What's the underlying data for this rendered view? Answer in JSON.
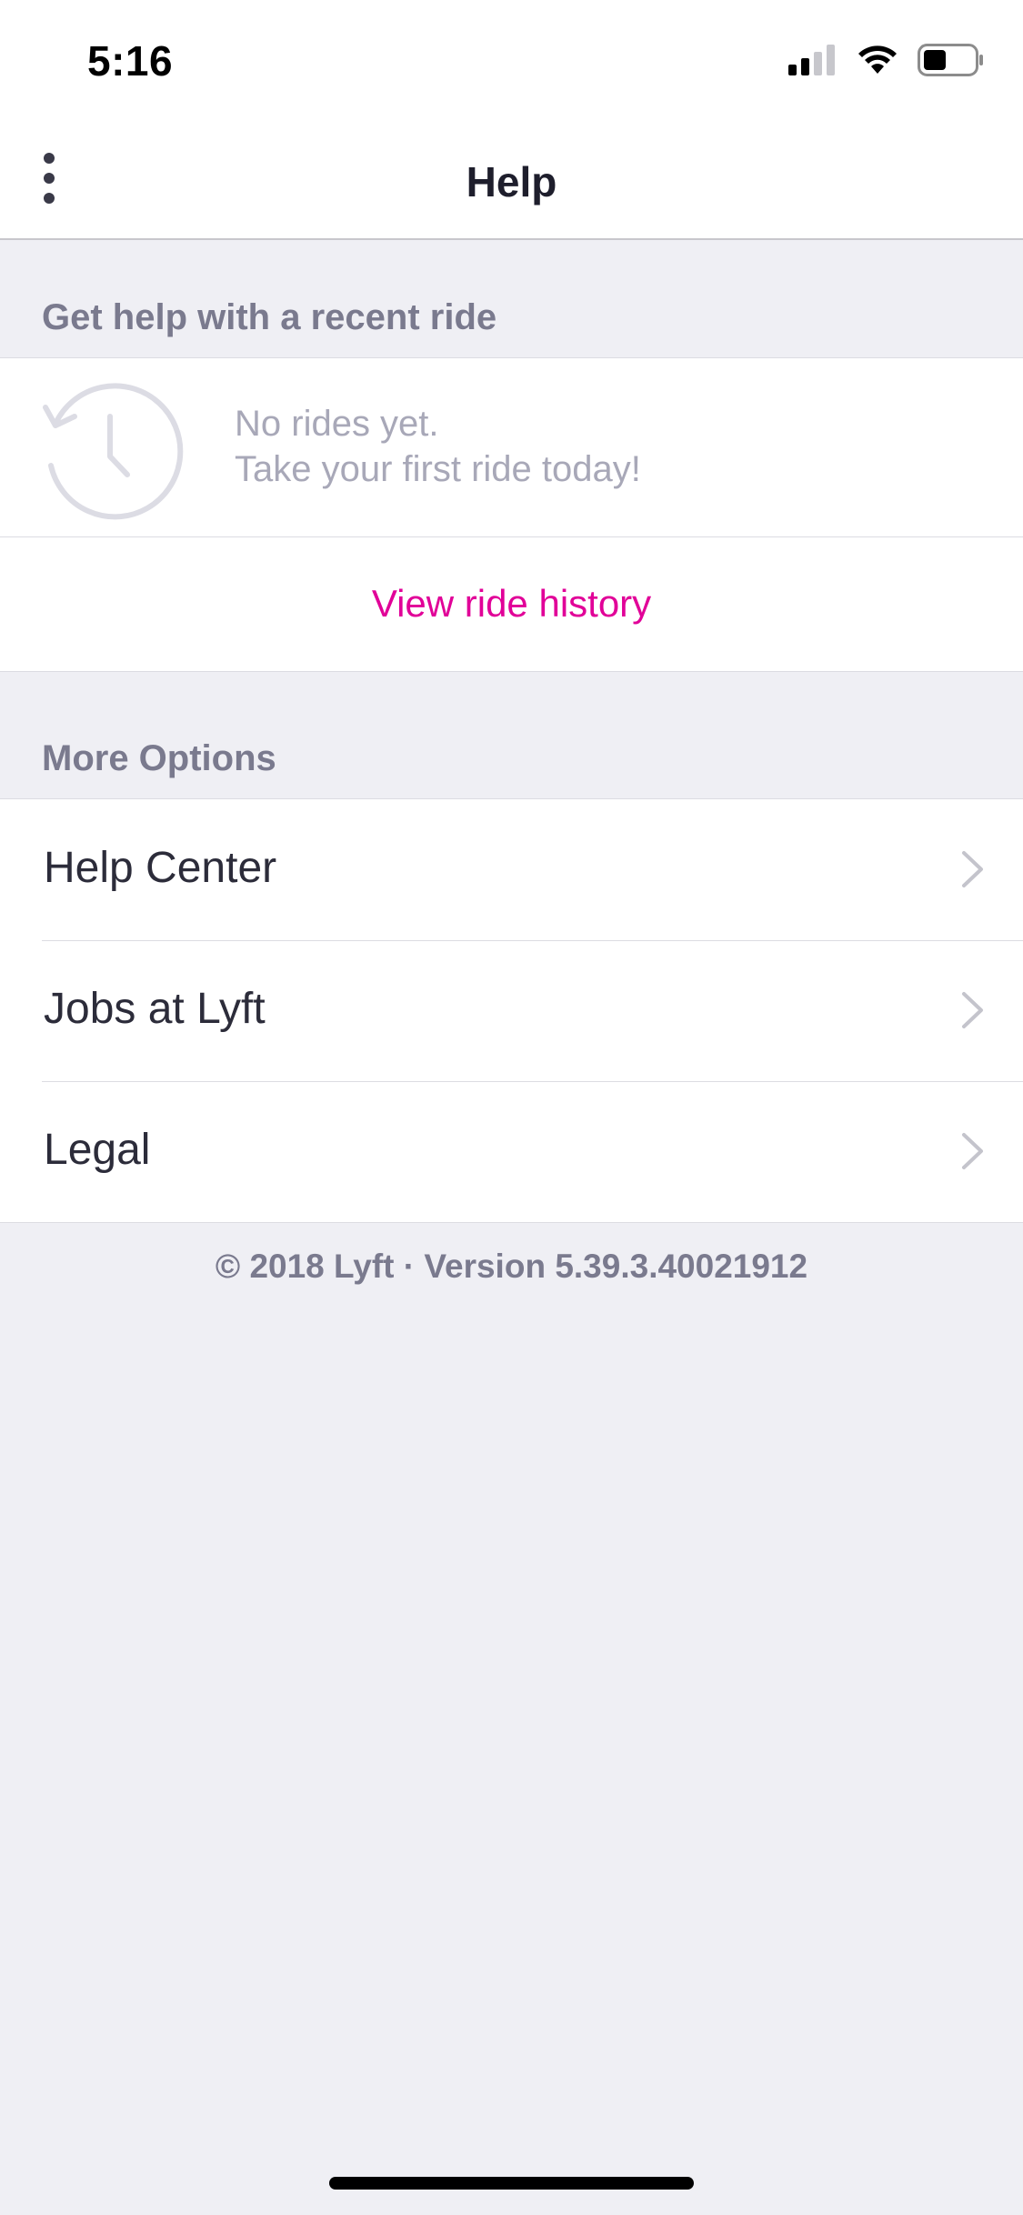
{
  "status_bar": {
    "time": "5:16",
    "icons": [
      "cellular-signal-icon",
      "wifi-icon",
      "battery-icon"
    ]
  },
  "nav": {
    "title": "Help",
    "menu_icon": "more-vertical-icon"
  },
  "recent_ride": {
    "section_title": "Get help with a recent ride",
    "empty_icon": "history-clock-icon",
    "empty_line_1": "No rides yet.",
    "empty_line_2": "Take your first ride today!",
    "view_history_label": "View ride history"
  },
  "more_options": {
    "section_title": "More Options",
    "items": [
      {
        "label": "Help Center",
        "icon": "chevron-right-icon"
      },
      {
        "label": "Jobs at Lyft",
        "icon": "chevron-right-icon"
      },
      {
        "label": "Legal",
        "icon": "chevron-right-icon"
      }
    ]
  },
  "footer": {
    "text": "© 2018 Lyft · Version 5.39.3.40021912"
  },
  "colors": {
    "accent_pink": "#e10098",
    "background": "#efeff4",
    "section_text": "#7a7a8e"
  }
}
